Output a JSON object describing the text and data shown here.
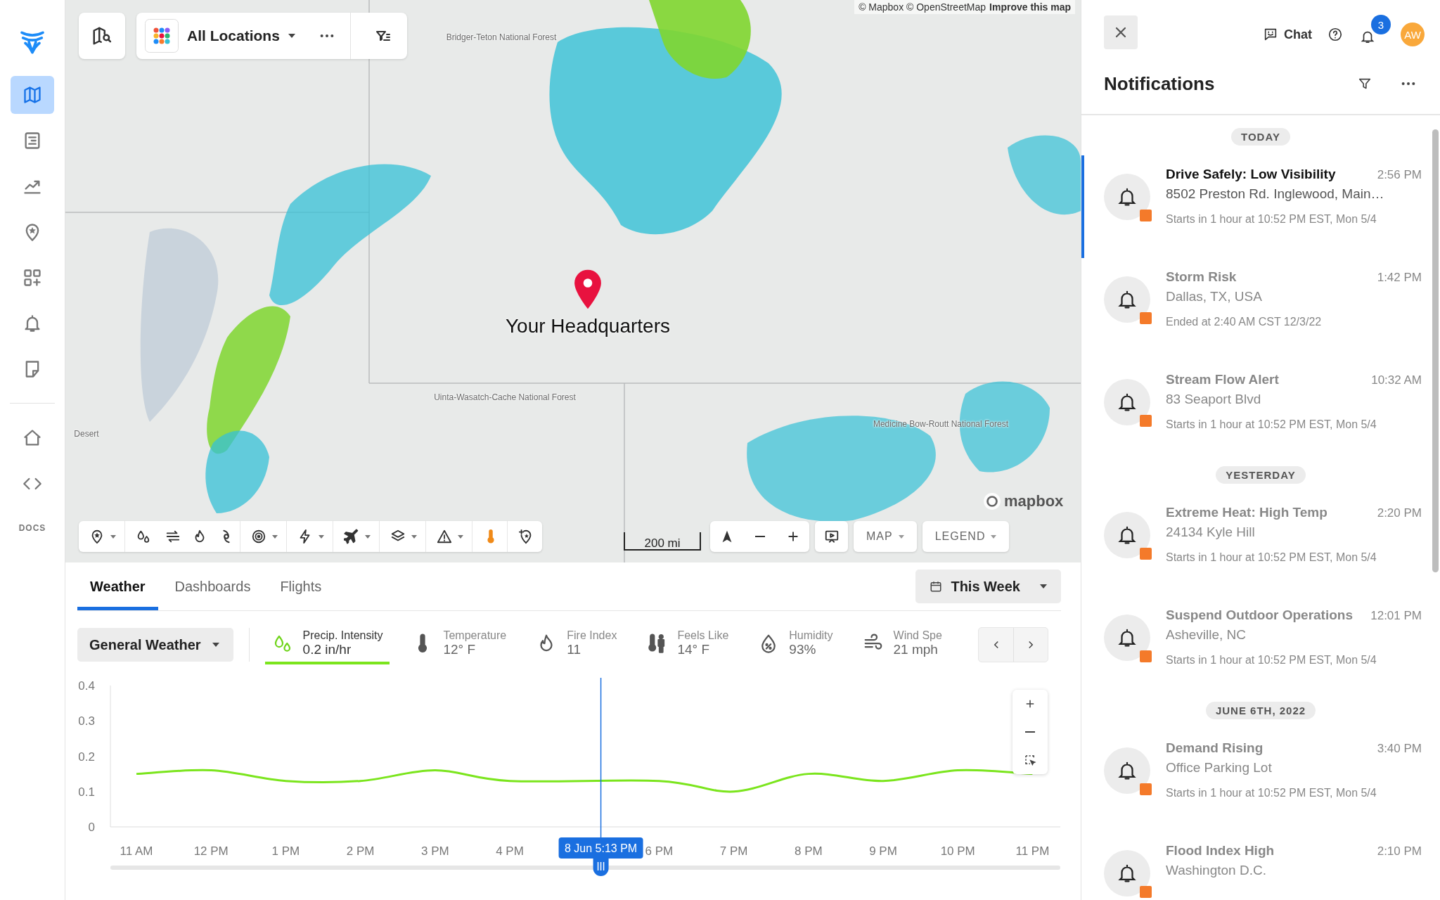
{
  "sidebar": {
    "items": [
      {
        "kind": "map",
        "selected": true
      },
      {
        "kind": "list",
        "selected": false
      },
      {
        "kind": "trend",
        "selected": false
      },
      {
        "kind": "pin-star",
        "selected": false
      },
      {
        "kind": "widgets",
        "selected": false
      },
      {
        "kind": "bell",
        "selected": false
      },
      {
        "kind": "note",
        "selected": false
      }
    ],
    "bottom_items": [
      {
        "kind": "home"
      },
      {
        "kind": "code"
      }
    ],
    "docs_label": "DOCS"
  },
  "map": {
    "location_selector": {
      "label": "All Locations"
    },
    "attribution": "© Mapbox © OpenStreetMap",
    "attribution_link": "Improve this map",
    "labels": [
      "Bridger-Teton National Forest",
      "Uinta-Wasatch-Cache National Forest",
      "Medicine Bow-Routt National Forest",
      "Desert"
    ],
    "marker_label": "Your Headquarters",
    "scale": "200 mi",
    "logo": "mapbox",
    "tools": [
      {
        "kind": "pin-star",
        "menu": true,
        "active": false
      },
      {
        "kind": "drops",
        "menu": false,
        "active": false
      },
      {
        "kind": "wind",
        "menu": false,
        "active": false
      },
      {
        "kind": "fire",
        "menu": false,
        "active": false
      },
      {
        "kind": "hurricane",
        "menu": false,
        "active": false
      },
      {
        "kind": "radar",
        "menu": true,
        "active": false
      },
      {
        "kind": "lightning",
        "menu": true,
        "active": false
      },
      {
        "kind": "plane",
        "menu": true,
        "active": false
      },
      {
        "kind": "layers",
        "menu": true,
        "active": false
      },
      {
        "kind": "warning",
        "menu": true,
        "active": false
      },
      {
        "kind": "thermometer",
        "menu": false,
        "active": true
      },
      {
        "kind": "pin-plus",
        "menu": false,
        "active": false
      }
    ],
    "style_button": "MAP",
    "legend_button": "LEGEND"
  },
  "bottom_panel": {
    "tabs": [
      {
        "label": "Weather",
        "selected": true
      },
      {
        "label": "Dashboards",
        "selected": false
      },
      {
        "label": "Flights",
        "selected": false
      }
    ],
    "range": "This Week",
    "preset": "General Weather",
    "metrics": [
      {
        "kind": "precip",
        "label": "Precip. Intensity",
        "value": "0.2 in/hr",
        "selected": true
      },
      {
        "kind": "temperature",
        "label": "Temperature",
        "value": "12° F",
        "selected": false
      },
      {
        "kind": "fire",
        "label": "Fire Index",
        "value": "11",
        "selected": false
      },
      {
        "kind": "feels",
        "label": "Feels Like",
        "value": "14° F",
        "selected": false
      },
      {
        "kind": "humidity",
        "label": "Humidity",
        "value": "93%",
        "selected": false
      },
      {
        "kind": "wind",
        "label": "Wind Spe",
        "value": "21 mph",
        "selected": false
      }
    ],
    "chart": {
      "cursor_label": "8 Jun 5:13 PM",
      "chart_data": {
        "type": "line",
        "categories": [
          "11 AM",
          "12 PM",
          "1 PM",
          "2 PM",
          "3 PM",
          "4 PM",
          "6 PM",
          "7 PM",
          "8 PM",
          "9 PM",
          "10 PM",
          "11 PM"
        ],
        "series": [
          {
            "color": "#7be51d",
            "values": [
              0.15,
              0.16,
              0.13,
              0.13,
              0.16,
              0.13,
              0.13,
              0.1,
              0.15,
              0.13,
              0.16,
              0.15
            ]
          }
        ],
        "ylim": [
          0,
          0.4
        ],
        "yticks": [
          0,
          0.1,
          0.2,
          0.3,
          0.4
        ]
      }
    }
  },
  "header": {
    "chat": "Chat",
    "badge": "3",
    "avatar": "AW"
  },
  "notifications": {
    "title": "Notifications",
    "groups": [
      {
        "label": "TODAY",
        "items": [
          {
            "title": "Drive Safely: Low Visibility",
            "time": "2:56 PM",
            "location": "8502 Preston Rd. Inglewood, Main…",
            "detail": "Starts in 1 hour at 10:52 PM EST, Mon 5/4",
            "selected": true
          },
          {
            "title": "Storm Risk",
            "time": "1:42 PM",
            "location": "Dallas, TX, USA",
            "detail": "Ended at 2:40 AM CST 12/3/22",
            "selected": false
          },
          {
            "title": "Stream Flow Alert",
            "time": "10:32 AM",
            "location": "83 Seaport Blvd",
            "detail": "Starts in 1 hour at 10:52 PM EST, Mon 5/4",
            "selected": false
          }
        ]
      },
      {
        "label": "YESTERDAY",
        "items": [
          {
            "title": "Extreme Heat: High Temp",
            "time": "2:20 PM",
            "location": "24134 Kyle Hill",
            "detail": "Starts in 1 hour at 10:52 PM EST, Mon 5/4",
            "selected": false
          },
          {
            "title": "Suspend Outdoor Operations",
            "time": "12:01 PM",
            "location": "Asheville, NC",
            "detail": "Starts in 1 hour at 10:52 PM EST, Mon 5/4",
            "selected": false
          }
        ]
      },
      {
        "label": "JUNE 6TH, 2022",
        "items": [
          {
            "title": "Demand Rising",
            "time": "3:40 PM",
            "location": "Office Parking Lot",
            "detail": "Starts in 1 hour at 10:52 PM EST, Mon 5/4",
            "selected": false
          },
          {
            "title": "Flood Index High",
            "time": "2:10 PM",
            "location": "Washington D.C.",
            "selected": false
          }
        ]
      }
    ]
  }
}
